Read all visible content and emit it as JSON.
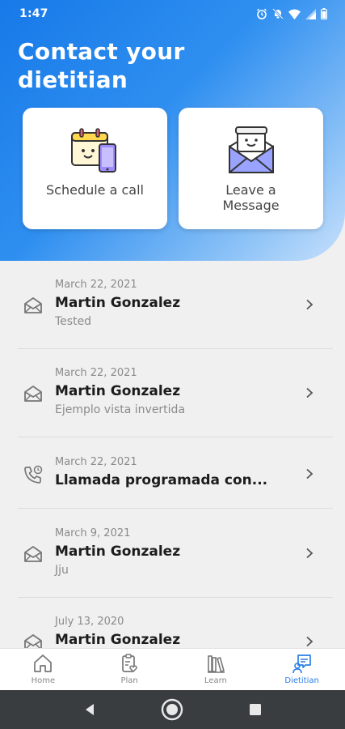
{
  "status_bar": {
    "time": "1:47",
    "icons": [
      "alarm-icon",
      "mute-icon",
      "wifi-icon",
      "signal-icon",
      "battery-icon"
    ]
  },
  "header": {
    "title": "Contact your dietitian",
    "actions": [
      {
        "label": "Schedule a call",
        "icon": "calendar-phone-icon"
      },
      {
        "label": "Leave a Message",
        "icon": "envelope-letter-icon"
      }
    ]
  },
  "messages": [
    {
      "type": "message",
      "icon": "envelope-icon",
      "date": "March 22, 2021",
      "title": "Martin Gonzalez",
      "subtitle": "Tested"
    },
    {
      "type": "message",
      "icon": "envelope-icon",
      "date": "March 22, 2021",
      "title": "Martin Gonzalez",
      "subtitle": "Ejemplo vista invertida"
    },
    {
      "type": "call",
      "icon": "phone-clock-icon",
      "date": "March 22, 2021",
      "title": "Llamada programada con...",
      "subtitle": ""
    },
    {
      "type": "message",
      "icon": "envelope-icon",
      "date": "March 9, 2021",
      "title": "Martin Gonzalez",
      "subtitle": "Jju"
    },
    {
      "type": "message",
      "icon": "envelope-icon",
      "date": "July 13, 2020",
      "title": "Martin Gonzalez",
      "subtitle": ""
    }
  ],
  "bottom_nav": {
    "items": [
      {
        "label": "Home",
        "icon": "home-icon",
        "active": false
      },
      {
        "label": "Plan",
        "icon": "clipboard-heart-icon",
        "active": false
      },
      {
        "label": "Learn",
        "icon": "books-icon",
        "active": false
      },
      {
        "label": "Dietitian",
        "icon": "chat-person-icon",
        "active": true
      }
    ]
  },
  "colors": {
    "accent": "#2a7fe6",
    "header_gradient_start": "#1779e8",
    "header_gradient_end": "#c7e0fb",
    "list_background": "#f0f0f0",
    "system_nav": "#3a3d40"
  }
}
